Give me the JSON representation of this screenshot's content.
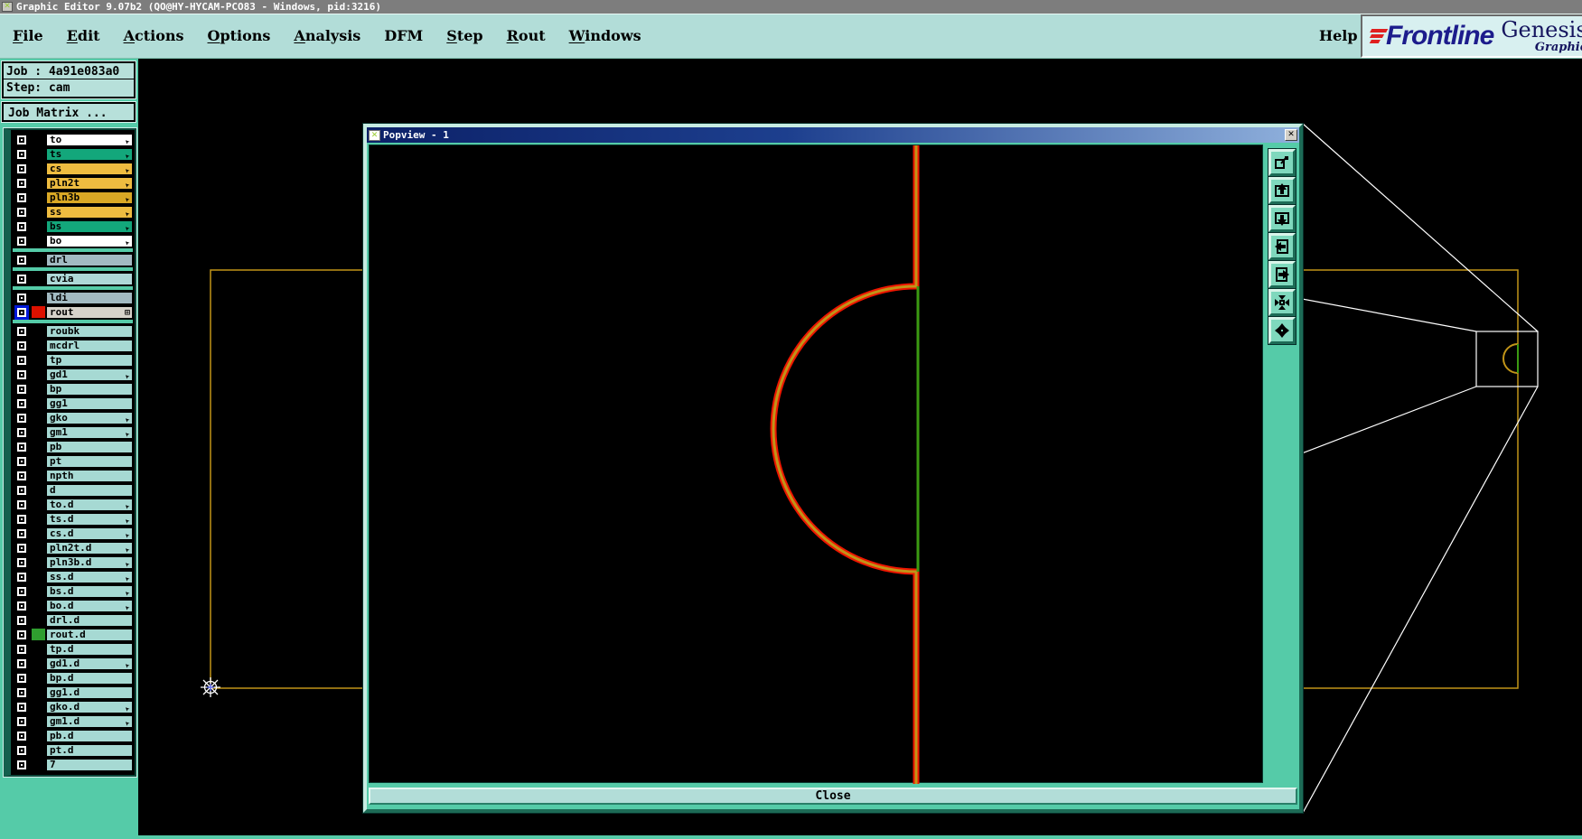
{
  "titlebar": {
    "title": "Graphic Editor 9.07b2 (QO@HY-HYCAM-PCO83 - Windows, pid:3216)",
    "icon": "x"
  },
  "menu": {
    "items": [
      {
        "label": "File",
        "underline": true
      },
      {
        "label": "Edit",
        "underline": true
      },
      {
        "label": "Actions",
        "underline": true
      },
      {
        "label": "Options",
        "underline": true
      },
      {
        "label": "Analysis",
        "underline": true
      },
      {
        "label": "DFM",
        "underline": false
      },
      {
        "label": "Step",
        "underline": true
      },
      {
        "label": "Rout",
        "underline": true
      },
      {
        "label": "Windows",
        "underline": true
      }
    ],
    "help": "Help"
  },
  "logo": {
    "brand": "Frontline",
    "product": "Genesis",
    "subtitle": "Graphic"
  },
  "sidebar": {
    "job": "Job : 4a91e083a0",
    "step": "Step: cam",
    "job_matrix": "Job Matrix ...",
    "layers": [
      {
        "name": "to",
        "bg": "#ffffff",
        "hand": true
      },
      {
        "name": "ts",
        "bg": "#13a77b",
        "hand": true
      },
      {
        "name": "cs",
        "bg": "#eebc40",
        "hand": true
      },
      {
        "name": "pln2t",
        "bg": "#eebc40",
        "hand": true
      },
      {
        "name": "pln3b",
        "bg": "#d9a825",
        "hand": true
      },
      {
        "name": "ss",
        "bg": "#eebc40",
        "hand": true
      },
      {
        "name": "bs",
        "bg": "#13a77b",
        "hand": true
      },
      {
        "name": "bo",
        "bg": "#ffffff",
        "hand": true,
        "gap_after": true
      },
      {
        "name": "drl",
        "bg": "#a2bac2",
        "gap_after": true
      },
      {
        "name": "cvia",
        "bg": "#aed8d8",
        "gap_after": true
      },
      {
        "name": "ldi",
        "bg": "#a2bac2"
      },
      {
        "name": "rout",
        "bg": "#d6d2ca",
        "selected": true,
        "swatch": "#dd1100",
        "grid_icon": true,
        "gap_after": true
      },
      {
        "name": "roubk",
        "bg": "#a6d9d3"
      },
      {
        "name": "mcdrl",
        "bg": "#a6d9d3"
      },
      {
        "name": "tp",
        "bg": "#a6d9d3"
      },
      {
        "name": "gd1",
        "bg": "#a6d9d3",
        "hand": true
      },
      {
        "name": "bp",
        "bg": "#a6d9d3"
      },
      {
        "name": "gg1",
        "bg": "#a6d9d3"
      },
      {
        "name": "gko",
        "bg": "#a6d9d3",
        "hand": true
      },
      {
        "name": "gm1",
        "bg": "#a6d9d3",
        "hand": true
      },
      {
        "name": "pb",
        "bg": "#a6d9d3"
      },
      {
        "name": "pt",
        "bg": "#a6d9d3"
      },
      {
        "name": "npth",
        "bg": "#a6d9d3"
      },
      {
        "name": "d",
        "bg": "#a6d9d3"
      },
      {
        "name": "to.d",
        "bg": "#a6d9d3",
        "hand": true
      },
      {
        "name": "ts.d",
        "bg": "#a6d9d3",
        "hand": true
      },
      {
        "name": "cs.d",
        "bg": "#a6d9d3",
        "hand": true
      },
      {
        "name": "pln2t.d",
        "bg": "#a6d9d3",
        "hand": true
      },
      {
        "name": "pln3b.d",
        "bg": "#a6d9d3",
        "hand": true
      },
      {
        "name": "ss.d",
        "bg": "#a6d9d3",
        "hand": true
      },
      {
        "name": "bs.d",
        "bg": "#a6d9d3",
        "hand": true
      },
      {
        "name": "bo.d",
        "bg": "#a6d9d3",
        "hand": true
      },
      {
        "name": "drl.d",
        "bg": "#a6d9d3"
      },
      {
        "name": "rout.d",
        "bg": "#a6d9d3",
        "swatch": "#2f9e2f"
      },
      {
        "name": "tp.d",
        "bg": "#a6d9d3"
      },
      {
        "name": "gd1.d",
        "bg": "#a6d9d3",
        "hand": true
      },
      {
        "name": "bp.d",
        "bg": "#a6d9d3"
      },
      {
        "name": "gg1.d",
        "bg": "#a6d9d3"
      },
      {
        "name": "gko.d",
        "bg": "#a6d9d3",
        "hand": true
      },
      {
        "name": "gm1.d",
        "bg": "#a6d9d3",
        "hand": true
      },
      {
        "name": "pb.d",
        "bg": "#a6d9d3"
      },
      {
        "name": "pt.d",
        "bg": "#a6d9d3"
      },
      {
        "name": "7",
        "bg": "#a6d9d3"
      }
    ]
  },
  "popview": {
    "title": "Popview - 1",
    "close_x": "x",
    "close_label": "Close",
    "toolbar_icons": [
      "open-popview",
      "pan-up",
      "pan-down",
      "pan-left",
      "pan-right",
      "zoom-contract",
      "zoom-expand"
    ]
  },
  "colors": {
    "teal_bg": "#55cba8",
    "chrome": "#b2ddd8",
    "gold_outline": "#c19418",
    "rout_highlight_red": "#ee1600",
    "chord_green": "#3b9a12",
    "popup_title_left": "#0c2168",
    "popup_title_right": "#8fb0dc",
    "logo_navy": "#1c1c8c",
    "logo_red": "#e02020",
    "titlebar_gray": "#7d7d7d"
  }
}
